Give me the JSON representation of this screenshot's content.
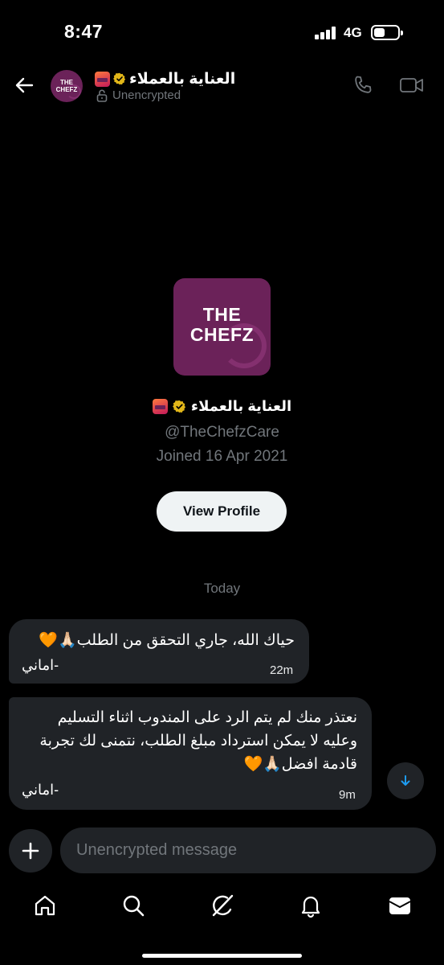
{
  "status_bar": {
    "time": "8:47",
    "network": "4G",
    "battery_percent": 45
  },
  "header": {
    "name": "العناية بالعملاء",
    "encryption": "Unencrypted"
  },
  "logo": {
    "line1": "THE",
    "line2": "CHEFZ",
    "brand_color": "#6b2259"
  },
  "profile": {
    "name": "العناية بالعملاء",
    "handle": "@TheChefzCare",
    "joined": "Joined 16 Apr 2021",
    "view_profile_label": "View Profile"
  },
  "conversation": {
    "day_label": "Today",
    "messages": [
      {
        "text": "حياك الله، جاري التحقق من الطلب🙏🏻🧡",
        "signature": "-اماني",
        "time": "22m"
      },
      {
        "text": "نعتذر منك لم يتم الرد على المندوب اثناء التسليم\nوعليه لا يمكن استرداد مبلغ الطلب، نتمنى لك تجربة\nقادمة افضل🙏🏻🧡",
        "signature": "-اماني",
        "time": "9m"
      }
    ]
  },
  "composer": {
    "placeholder": "Unencrypted message"
  },
  "colors": {
    "background": "#000000",
    "bubble": "#202327",
    "muted_text": "#71767b",
    "accent": "#1d9bf0",
    "verified_gold": "#e2b719"
  },
  "icons": {
    "back": "arrow-left-icon",
    "call": "phone-icon",
    "video": "video-camera-icon",
    "lock": "unlocked-padlock-icon",
    "verified": "verified-badge-icon",
    "add": "plus-icon",
    "scroll": "arrow-down-icon",
    "nav": [
      "home-icon",
      "search-icon",
      "grok-icon",
      "bell-icon",
      "messages-icon"
    ]
  }
}
